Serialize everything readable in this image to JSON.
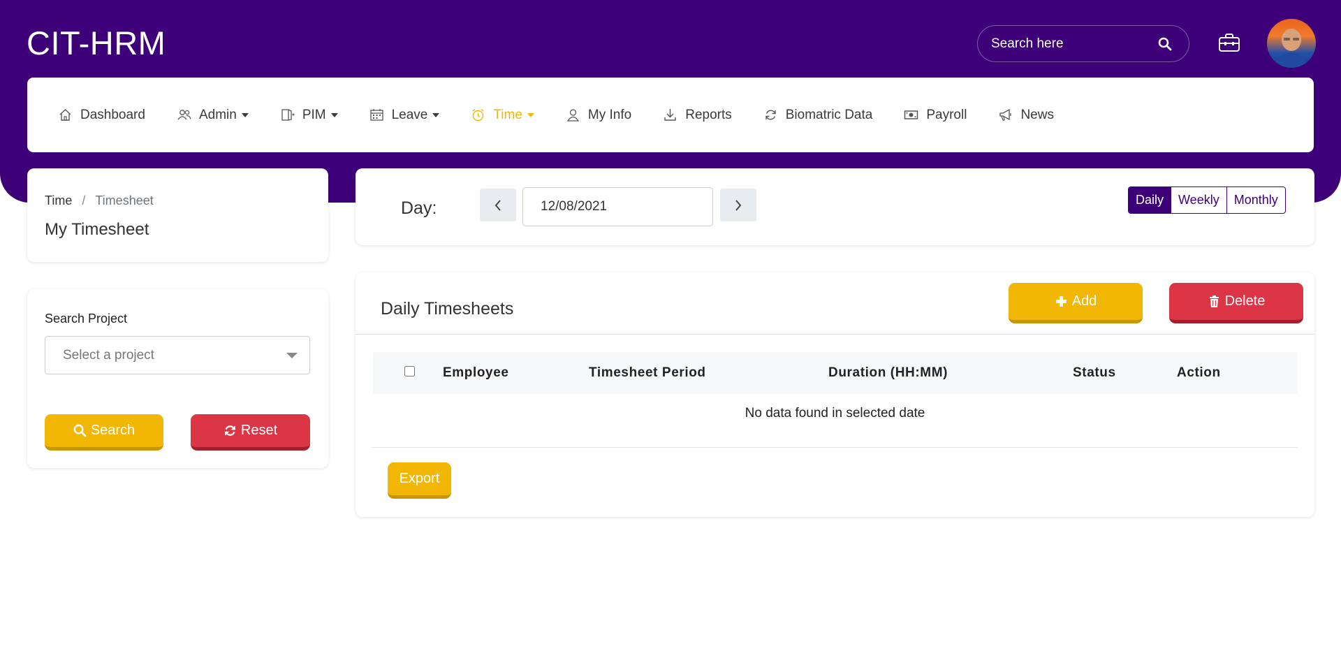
{
  "header": {
    "brand": "CIT-HRM",
    "search_placeholder": "Search here"
  },
  "nav": [
    {
      "label": "Dashboard",
      "icon": "home-icon",
      "dropdown": false
    },
    {
      "label": "Admin",
      "icon": "users-icon",
      "dropdown": true
    },
    {
      "label": "PIM",
      "icon": "door-icon",
      "dropdown": true
    },
    {
      "label": "Leave",
      "icon": "calendar-icon",
      "dropdown": true
    },
    {
      "label": "Time",
      "icon": "clock-icon",
      "dropdown": true,
      "active": true
    },
    {
      "label": "My Info",
      "icon": "user-icon",
      "dropdown": false
    },
    {
      "label": "Reports",
      "icon": "download-icon",
      "dropdown": false
    },
    {
      "label": "Biomatric Data",
      "icon": "refresh-icon",
      "dropdown": false
    },
    {
      "label": "Payroll",
      "icon": "money-icon",
      "dropdown": false
    },
    {
      "label": "News",
      "icon": "megaphone-icon",
      "dropdown": false
    }
  ],
  "breadcrumb": {
    "parent": "Time",
    "separator": "/",
    "current": "Timesheet"
  },
  "page_title": "My Timesheet",
  "search_project": {
    "label": "Search Project",
    "select_placeholder": "Select a project",
    "search_button": "Search",
    "reset_button": "Reset"
  },
  "day_selector": {
    "label": "Day:",
    "date": "12/08/2021",
    "periods": [
      "Daily",
      "Weekly",
      "Monthly"
    ],
    "selected_period": "Daily"
  },
  "timesheets": {
    "title": "Daily Timesheets",
    "add_button": "Add",
    "delete_button": "Delete",
    "columns": [
      "Employee",
      "Timesheet Period",
      "Duration (HH:MM)",
      "Status",
      "Action"
    ],
    "empty_message": "No data found in selected date",
    "export_button": "Export"
  },
  "colors": {
    "primary": "#3d0079",
    "accent": "#f2b705",
    "danger": "#dc3545"
  }
}
